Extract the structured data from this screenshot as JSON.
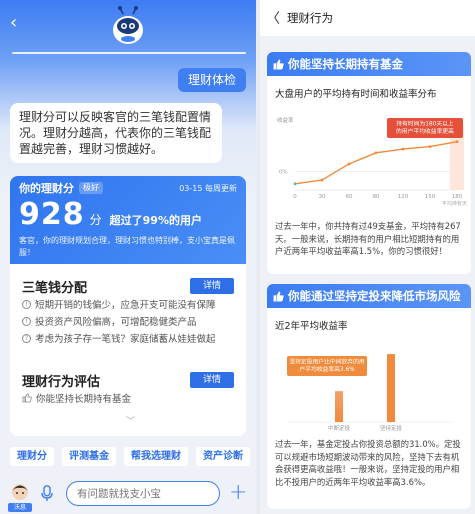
{
  "left": {
    "user_message": "理财体检",
    "bot_message": "理财分可以反映客官的三笔钱配置情况。理财分越高，代表你的三笔钱配置越完善，理财习惯越好。",
    "score_card": {
      "title": "你的理财分",
      "badge": "极好",
      "date": "03-15 每周更新",
      "score": "928",
      "unit": "分",
      "beat": "超过了99%的用户",
      "desc": "客官，你的理财规划合理，理财习惯也特别棒，支小宝真是佩服！"
    },
    "section1": {
      "title": "三笔钱分配",
      "detail_label": "详情",
      "items": [
        "短期开销的钱偏少，应急开支可能没有保障",
        "投资资产风险偏高，可增配稳健类产品",
        "考虑为孩子存一笔钱？家庭储蓄从娃娃做起"
      ]
    },
    "section2": {
      "title": "理财行为评估",
      "detail_label": "详情",
      "item": "你能坚持长期持有基金"
    },
    "shortcuts": [
      "理财分",
      "评测基金",
      "帮我选理财",
      "资产诊断"
    ],
    "input_placeholder": "有问题就找支小宝",
    "avatar_tag": "沃息"
  },
  "right": {
    "header_title": "理财行为",
    "card1": {
      "title": "你能坚持长期持有基金",
      "chart_title": "大盘用户的平均持有时间和收益率分布",
      "paragraph": "过去一年中，你共持有过49支基金，平均持有267天。一般来说，长期持有的用户相比短期持有的用户近两年平均收益率高1.5%，你的习惯很好！"
    },
    "card2": {
      "title": "你能通过坚持定投来降低市场风险",
      "chart_title": "近2年平均收益率",
      "paragraph": "过去一年，基金定投占你投资总额的31.0%。定投可以规避市场短期波动带来的风险，坚持下去有机会获得更高收益哦！一般来说，坚持定投的用户相比不投用户的近两年平均收益率高3.6%。"
    },
    "colors": {
      "primary": "#3f7ff2",
      "orange": "#f08a3c",
      "red": "#e4503a"
    }
  },
  "chart_data": [
    {
      "type": "line",
      "title": "大盘用户的平均持有时间和收益率分布",
      "ylabel": "收益率",
      "xlabel": "平均持有天数",
      "x": [
        0,
        30,
        60,
        90,
        120,
        150,
        180
      ],
      "x_tick_labels": [
        "0",
        "30",
        "60",
        "90",
        "120",
        "150",
        "180"
      ],
      "y_tick_labels": [
        "0%"
      ],
      "series": [
        {
          "values": [
            -1.0,
            -0.7,
            0.6,
            1.5,
            1.8,
            2.0,
            2.4
          ]
        }
      ],
      "ylim": [
        -1.5,
        3.5
      ],
      "annotation": "持有时间为180天以上的用户平均收益率更高",
      "highlight_x": 180
    },
    {
      "type": "bar",
      "title": "近2年平均收益率",
      "categories": [
        "中断定投",
        "坚持定投"
      ],
      "values": [
        3.0,
        6.6
      ],
      "ylim": [
        0,
        7
      ],
      "annotation": "坚持定投用户比中间放弃的用户平均收益率高3.6%"
    }
  ]
}
